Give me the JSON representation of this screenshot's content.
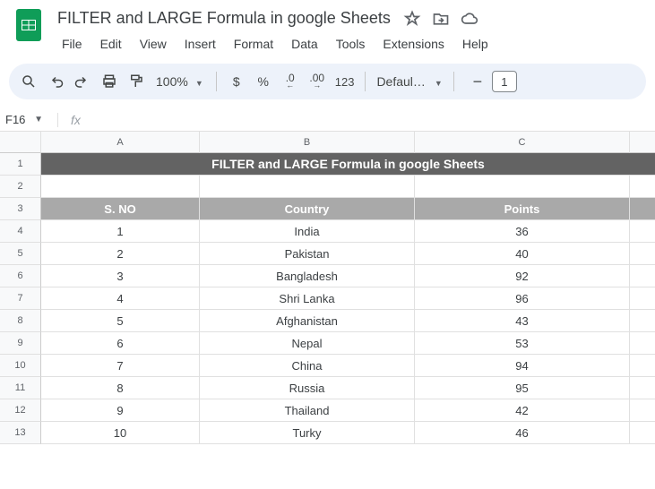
{
  "doc_title": "FILTER and LARGE Formula in google Sheets",
  "menubar": [
    "File",
    "Edit",
    "View",
    "Insert",
    "Format",
    "Data",
    "Tools",
    "Extensions",
    "Help"
  ],
  "toolbar": {
    "zoom": "100%",
    "currency": "$",
    "percent": "%",
    "dec_dec": ".0",
    "inc_dec": ".00",
    "numfmt": "123",
    "font": "Defaul…",
    "minus": "−",
    "fontsize": "1"
  },
  "namebox": "F16",
  "fx_label": "fx",
  "columns": [
    "A",
    "B",
    "C"
  ],
  "row_numbers": [
    1,
    2,
    3,
    4,
    5,
    6,
    7,
    8,
    9,
    10,
    11,
    12,
    13
  ],
  "sheet": {
    "title_row": "FILTER and LARGE Formula in google Sheets",
    "headers": [
      "S. NO",
      "Country",
      "Points"
    ],
    "data": [
      [
        1,
        "India",
        36
      ],
      [
        2,
        "Pakistan",
        40
      ],
      [
        3,
        "Bangladesh",
        92
      ],
      [
        4,
        "Shri Lanka",
        96
      ],
      [
        5,
        "Afghanistan",
        43
      ],
      [
        6,
        "Nepal",
        53
      ],
      [
        7,
        "China",
        94
      ],
      [
        8,
        "Russia",
        95
      ],
      [
        9,
        "Thailand",
        42
      ],
      [
        10,
        "Turky",
        46
      ]
    ]
  },
  "chart_data": {
    "type": "table",
    "title": "FILTER and LARGE Formula in google Sheets",
    "columns": [
      "S. NO",
      "Country",
      "Points"
    ],
    "rows": [
      [
        1,
        "India",
        36
      ],
      [
        2,
        "Pakistan",
        40
      ],
      [
        3,
        "Bangladesh",
        92
      ],
      [
        4,
        "Shri Lanka",
        96
      ],
      [
        5,
        "Afghanistan",
        43
      ],
      [
        6,
        "Nepal",
        53
      ],
      [
        7,
        "China",
        94
      ],
      [
        8,
        "Russia",
        95
      ],
      [
        9,
        "Thailand",
        42
      ],
      [
        10,
        "Turky",
        46
      ]
    ]
  }
}
